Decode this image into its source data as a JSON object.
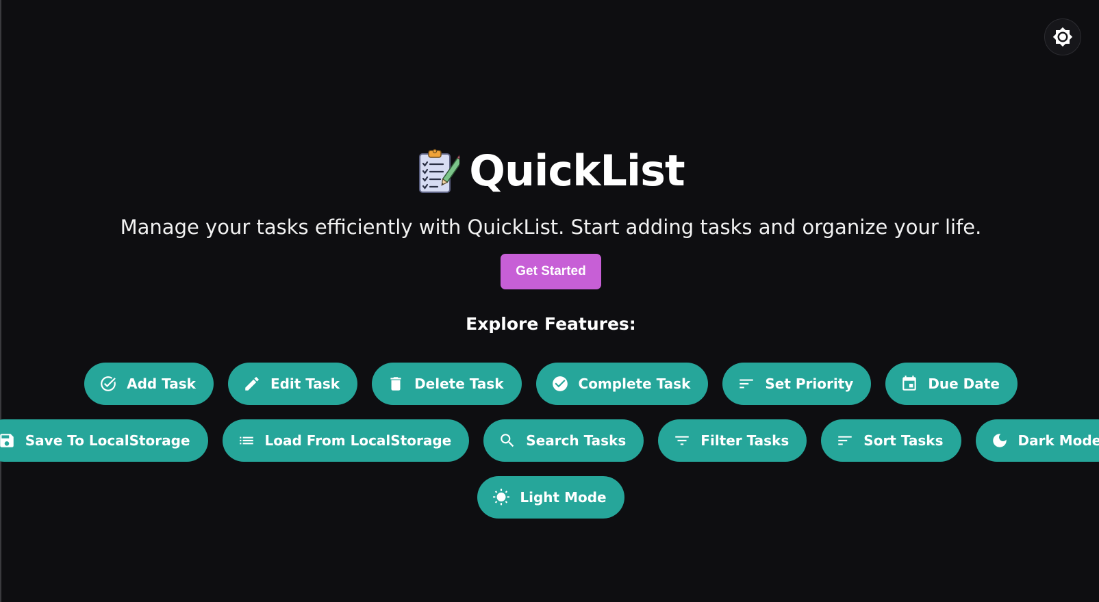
{
  "header": {
    "theme_toggle_icon": "brightness-icon"
  },
  "hero": {
    "logo_icon": "clipboard-checklist-icon",
    "title": "QuickList",
    "subtitle": "Manage your tasks efficiently with QuickList. Start adding tasks and organize your life.",
    "cta_label": "Get Started",
    "cta_color": "#c75fd6",
    "explore_heading": "Explore Features:"
  },
  "features": {
    "pill_color": "#26a69a",
    "rows": [
      [
        {
          "label": "Add Task",
          "icon": "check-circle-icon"
        },
        {
          "label": "Edit Task",
          "icon": "pencil-icon"
        },
        {
          "label": "Delete Task",
          "icon": "trash-icon"
        },
        {
          "label": "Complete Task",
          "icon": "check-filled-icon"
        },
        {
          "label": "Set Priority",
          "icon": "sort-lines-icon"
        },
        {
          "label": "Due Date",
          "icon": "calendar-icon"
        }
      ],
      [
        {
          "label": "Save To LocalStorage",
          "icon": "save-icon"
        },
        {
          "label": "Load From LocalStorage",
          "icon": "list-icon"
        },
        {
          "label": "Search Tasks",
          "icon": "search-icon"
        },
        {
          "label": "Filter Tasks",
          "icon": "filter-icon"
        },
        {
          "label": "Sort Tasks",
          "icon": "sort-lines-icon"
        },
        {
          "label": "Dark Mode",
          "icon": "moon-icon"
        }
      ],
      [
        {
          "label": "Light Mode",
          "icon": "sun-icon"
        }
      ]
    ]
  }
}
